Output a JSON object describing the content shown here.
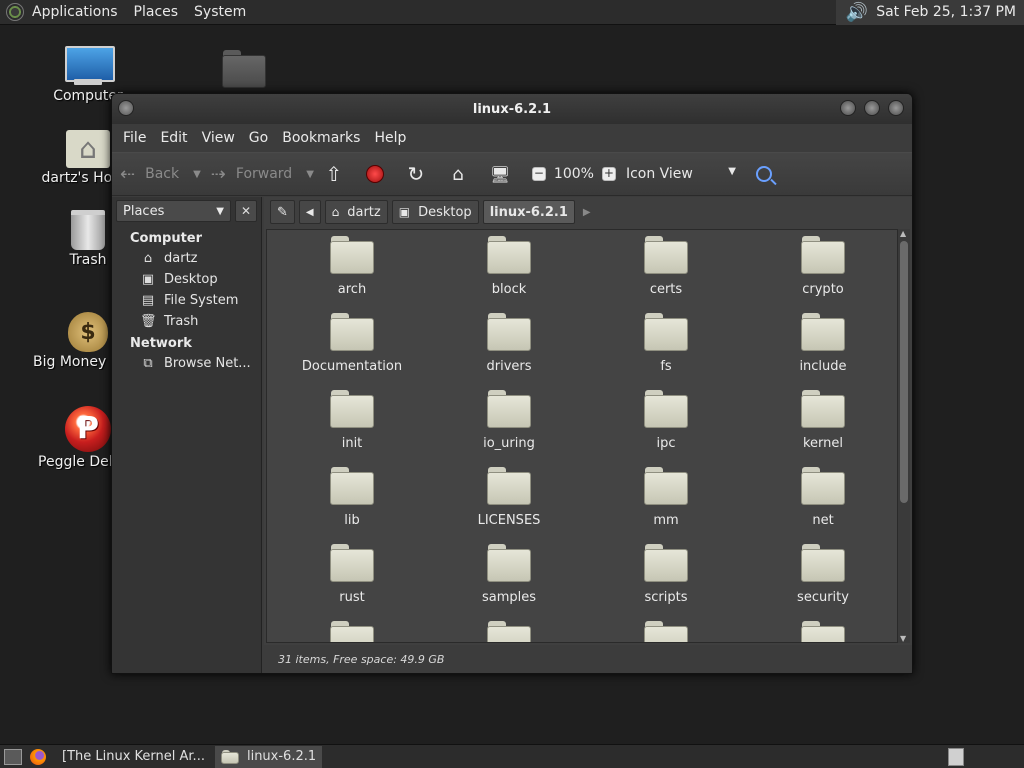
{
  "top_panel": {
    "menus": [
      "Applications",
      "Places",
      "System"
    ],
    "clock": "Sat Feb 25,  1:37 PM"
  },
  "desktop": {
    "icons": [
      {
        "label": "Computer",
        "icon": "computer-icon"
      },
      {
        "label": "dartz's Home",
        "icon": "home-folder-icon"
      },
      {
        "label": "Trash",
        "icon": "trash-icon"
      },
      {
        "label": "Big Money Deluxe",
        "icon": "money-bag-icon"
      },
      {
        "label": "Peggle Deluxe",
        "icon": "peggle-icon"
      }
    ]
  },
  "window": {
    "title": "linux-6.2.1",
    "menu": [
      "File",
      "Edit",
      "View",
      "Go",
      "Bookmarks",
      "Help"
    ],
    "toolbar": {
      "back": "Back",
      "forward": "Forward",
      "zoom": "100%",
      "view_mode": "Icon View"
    },
    "sidebar": {
      "selector": "Places",
      "sections": [
        {
          "heading": "Computer",
          "items": [
            {
              "label": "dartz",
              "icon": "home-icon"
            },
            {
              "label": "Desktop",
              "icon": "desktop-icon"
            },
            {
              "label": "File System",
              "icon": "drive-icon"
            },
            {
              "label": "Trash",
              "icon": "trash-icon"
            }
          ]
        },
        {
          "heading": "Network",
          "items": [
            {
              "label": "Browse Net...",
              "icon": "network-icon"
            }
          ]
        }
      ]
    },
    "breadcrumbs": [
      "dartz",
      "Desktop",
      "linux-6.2.1"
    ],
    "files": [
      "arch",
      "block",
      "certs",
      "crypto",
      "Documentation",
      "drivers",
      "fs",
      "include",
      "init",
      "io_uring",
      "ipc",
      "kernel",
      "lib",
      "LICENSES",
      "mm",
      "net",
      "rust",
      "samples",
      "scripts",
      "security",
      "",
      "",
      "",
      ""
    ],
    "status": "31 items, Free space: 49.9 GB"
  },
  "taskbar": {
    "tasks": [
      "[The Linux Kernel Ar...",
      "linux-6.2.1"
    ]
  }
}
